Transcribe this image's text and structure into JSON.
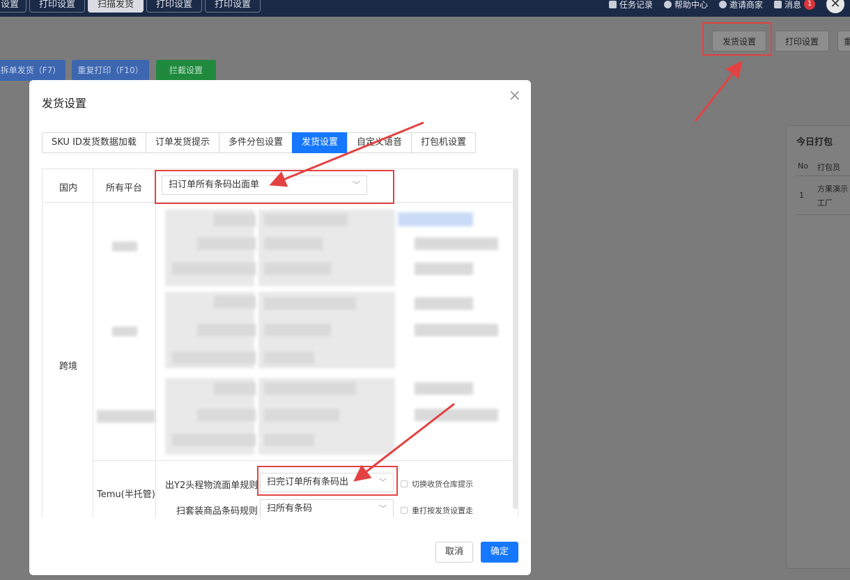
{
  "topbar": {
    "tabs": [
      "设置",
      "打印设置",
      "扫描发货",
      "打印设置",
      "打印设置"
    ],
    "active_tab_index": 2,
    "right_items": [
      "任务记录",
      "帮助中心",
      "邀请商家",
      "消息"
    ],
    "message_badge": "1",
    "avatar_glyph": "✕"
  },
  "page": {
    "actions": [
      "拆单发货（F7）",
      "重复打印（F10）",
      "拦截设置"
    ],
    "top_buttons": [
      "发货设置",
      "打印设置",
      "重"
    ],
    "right_panel": {
      "title": "今日打包",
      "columns": [
        "No",
        "打包员"
      ],
      "rows": [
        {
          "no": "1",
          "packer_line1": "方果演示",
          "packer_line2": "工厂"
        }
      ]
    }
  },
  "modal": {
    "title": "发货设置",
    "close_glyph": "×",
    "tabs": [
      "SKU ID发货数据加载",
      "订单发货提示",
      "多件分包设置",
      "发货设置",
      "自定义语音",
      "打包机设置"
    ],
    "active_tab_index": 3,
    "sections": {
      "domestic": {
        "label": "国内",
        "platform": "所有平台",
        "select_value": "扫订单所有条码出面单"
      },
      "cross_border": {
        "label": "跨境",
        "temu": {
          "label": "Temu(半托管)",
          "rule1_label": "出Y2头程物流面单规则",
          "rule1_value": "扫完订单所有条码出",
          "rule1_checkbox": "切换收货仓库提示",
          "rule2_label": "扫套装商品条码规则",
          "rule2_value": "扫所有条码",
          "rule2_checkbox": "重打按发货设置走"
        }
      }
    },
    "cancel_label": "取消",
    "ok_label": "确定"
  },
  "colors": {
    "primary": "#1677ff",
    "highlight_red": "#e34242",
    "topbar_bg": "#1b2a47",
    "overlay_gray": "#7b7b7b"
  }
}
